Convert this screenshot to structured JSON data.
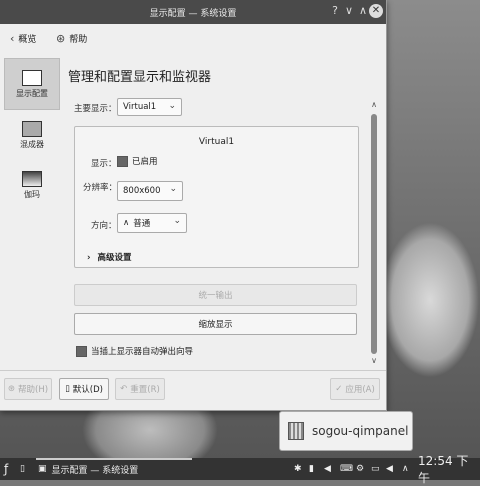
{
  "window": {
    "title": "显示配置 — 系统设置",
    "controls": {
      "help": "?",
      "minimize": "∨",
      "maximize": "∧",
      "close": "✕"
    }
  },
  "toolbar": {
    "overview": "概览",
    "help": "帮助"
  },
  "sidebar": {
    "items": [
      {
        "label": "显示配置",
        "icon": "monitor-icon",
        "active": true
      },
      {
        "label": "混成器",
        "icon": "compositor-icon",
        "active": false
      },
      {
        "label": "伽玛",
        "icon": "gamma-icon",
        "active": false
      }
    ]
  },
  "main": {
    "heading": "管理和配置显示和监视器",
    "primary_label": "主要显示：",
    "primary_value": "Virtual1",
    "output_name": "Virtual1",
    "display_label": "显示：",
    "enabled_label": "已启用",
    "resolution_label": "分辨率：",
    "resolution_value": "800x600",
    "orientation_label": "方向：",
    "orientation_value": "普通",
    "advanced_label": "高级设置",
    "unify_button": "统一输出",
    "scale_button": "缩放显示",
    "autodialog_label": "当插上显示器自动弹出向导"
  },
  "footer": {
    "help": "帮助(H)",
    "defaults": "默认(D)",
    "reset": "重置(R)",
    "apply": "应用(A)"
  },
  "notification": {
    "text": "sogou-qimpanel"
  },
  "taskbar": {
    "task_title": "显示配置 — 系统设置",
    "clock": "12:54 下午"
  }
}
